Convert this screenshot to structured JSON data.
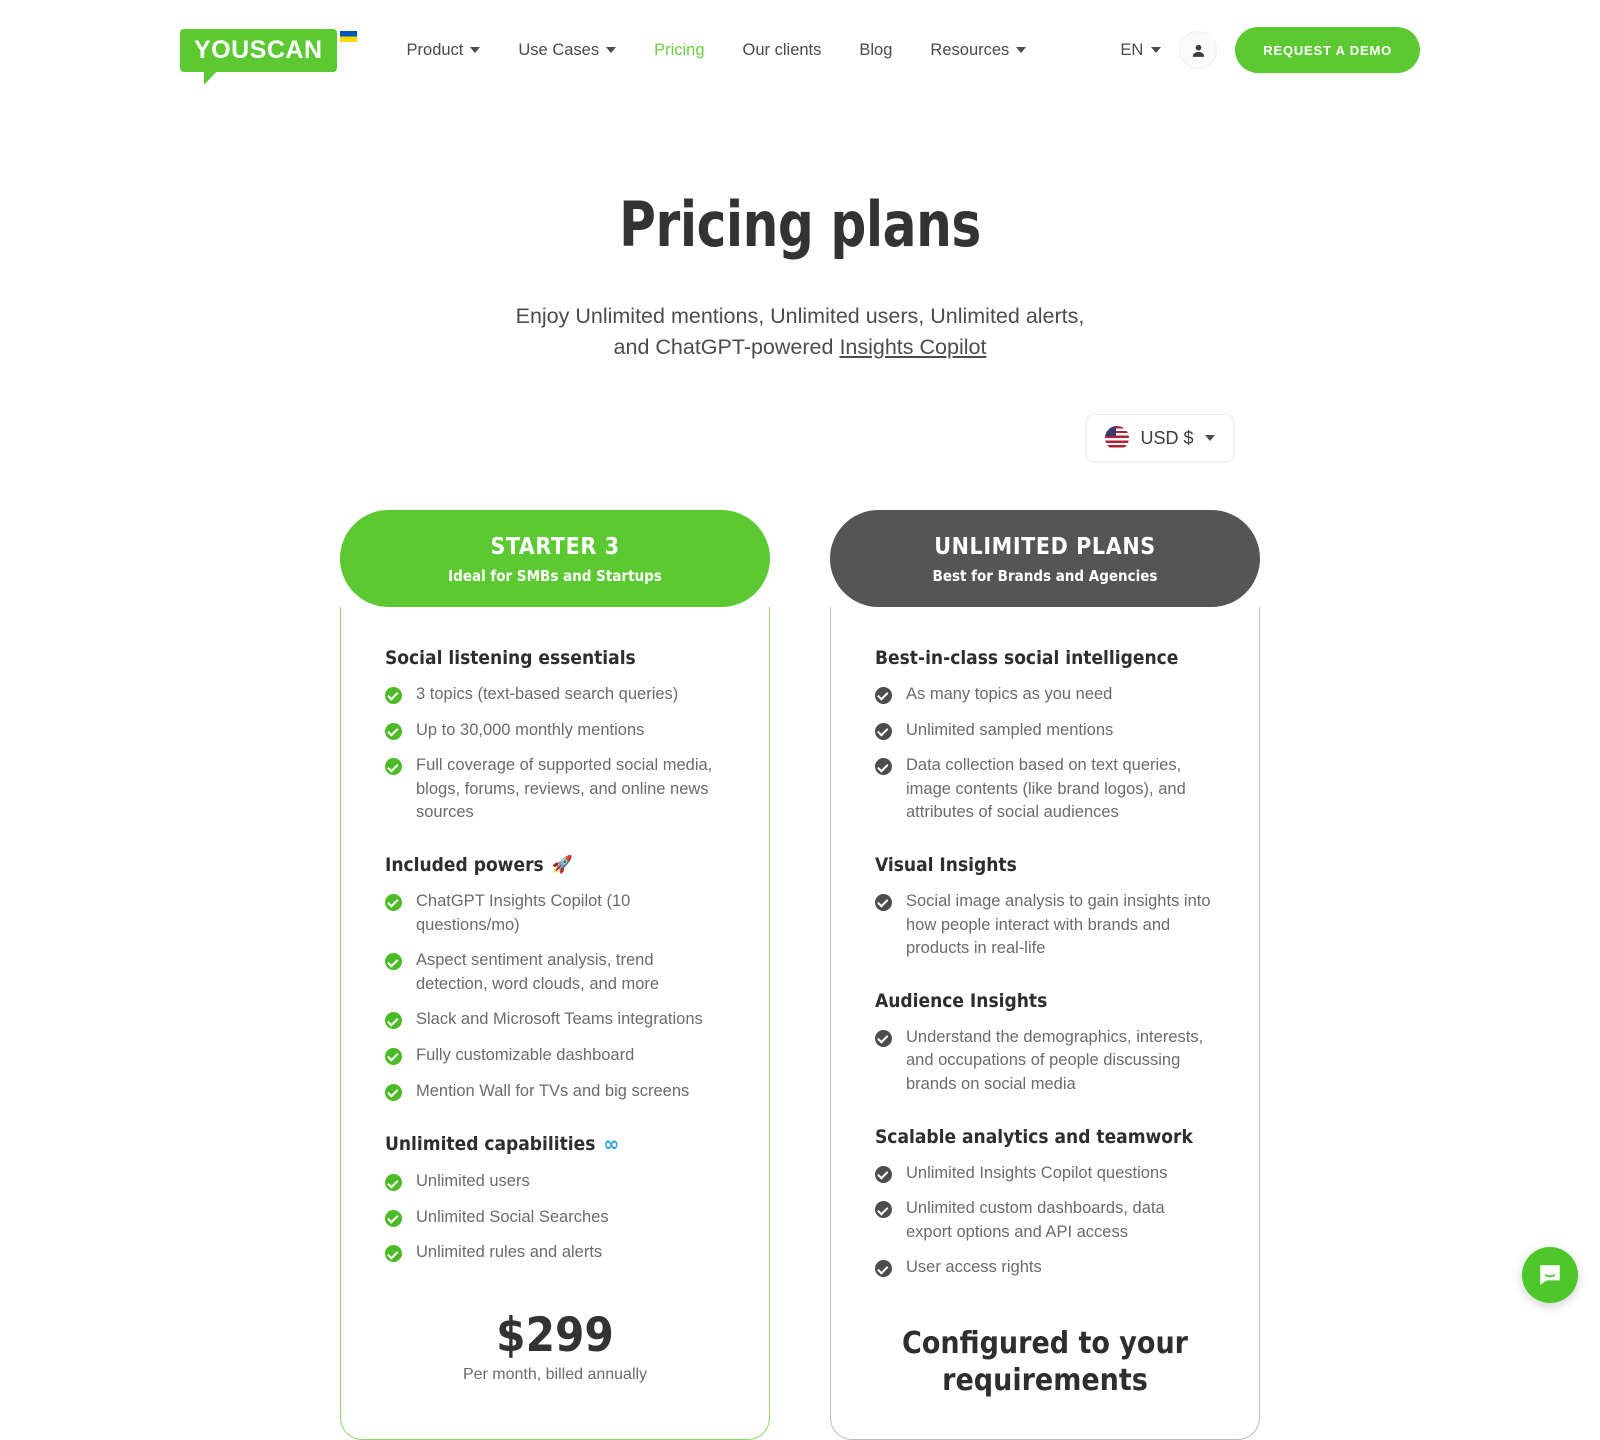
{
  "header": {
    "logo_text": "YOUSCAN",
    "nav": [
      {
        "label": "Product",
        "has_caret": true,
        "active": false
      },
      {
        "label": "Use Cases",
        "has_caret": true,
        "active": false
      },
      {
        "label": "Pricing",
        "has_caret": false,
        "active": true
      },
      {
        "label": "Our clients",
        "has_caret": false,
        "active": false
      },
      {
        "label": "Blog",
        "has_caret": false,
        "active": false
      },
      {
        "label": "Resources",
        "has_caret": true,
        "active": false
      }
    ],
    "language": "EN",
    "demo_button": "REQUEST A DEMO",
    "accent_color": "#5cc933"
  },
  "hero": {
    "title": "Pricing plans",
    "subtitle_line1": "Enjoy Unlimited mentions, Unlimited users, Unlimited alerts,",
    "subtitle_line2_prefix": "and ChatGPT-powered ",
    "subtitle_link": "Insights Copilot"
  },
  "currency": {
    "label": "USD $",
    "flag": "us-flag-icon"
  },
  "plans": [
    {
      "id": "starter",
      "title": "STARTER 3",
      "subtitle": "Ideal for SMBs and Startups",
      "header_color": "#5cc933",
      "check_color": "#4cbb27",
      "sections": [
        {
          "title": "Social listening essentials",
          "emoji": "",
          "features": [
            "3 topics (text-based search queries)",
            "Up to 30,000 monthly mentions",
            "Full coverage of supported social media, blogs, forums, reviews, and online news sources"
          ]
        },
        {
          "title": "Included powers",
          "emoji": "🚀",
          "features": [
            "ChatGPT Insights Copilot (10 questions/mo)",
            "Aspect sentiment analysis, trend detection, word clouds, and more",
            "Slack and Microsoft Teams integrations",
            "Fully customizable dashboard",
            "Mention Wall for TVs and big screens"
          ]
        },
        {
          "title": "Unlimited capabilities",
          "emoji": "∞",
          "features": [
            "Unlimited users",
            "Unlimited Social Searches",
            "Unlimited rules and alerts"
          ]
        }
      ],
      "footer_type": "price",
      "price": "$299",
      "price_note": "Per month, billed annually"
    },
    {
      "id": "unlimited",
      "title": "UNLIMITED PLANS",
      "subtitle": "Best for Brands and Agencies",
      "header_color": "#555555",
      "check_color": "#4d4d4d",
      "sections": [
        {
          "title": "Best-in-class social intelligence",
          "emoji": "",
          "features": [
            "As many topics as you need",
            "Unlimited sampled mentions",
            "Data collection based on text queries, image contents (like brand logos), and attributes of social audiences"
          ]
        },
        {
          "title": "Visual Insights",
          "emoji": "",
          "features": [
            "Social image analysis to gain insights into how people interact with brands and products in real-life"
          ]
        },
        {
          "title": "Audience Insights",
          "emoji": "",
          "features": [
            "Understand the demographics, interests, and occupations of people discussing brands on social media"
          ]
        },
        {
          "title": "Scalable analytics and teamwork",
          "emoji": "",
          "features": [
            "Unlimited Insights Copilot questions",
            "Unlimited custom dashboards, data export options and API access",
            "User access rights"
          ]
        }
      ],
      "footer_type": "text",
      "footer_text": "Configured to your requirements"
    }
  ],
  "chat_widget": {
    "icon": "chat-bubble-icon",
    "color": "#4dc62c"
  }
}
